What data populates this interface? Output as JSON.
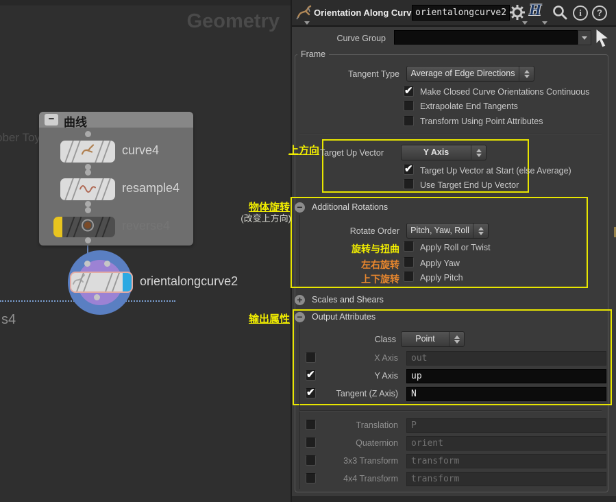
{
  "network": {
    "context_watermark": "Geometry",
    "clipped_box_label": "ober Toy",
    "clipped_node_label": "s4",
    "group_box": {
      "title": "曲线",
      "collapse_glyph": "−"
    },
    "nodes": {
      "curve": {
        "label": "curve4"
      },
      "resample": {
        "label": "resample4"
      },
      "reverse": {
        "label": "reverse4"
      },
      "orient": {
        "label": "orientalongcurve2"
      }
    }
  },
  "params": {
    "header": {
      "title": "Orientation Along Curve",
      "node_name": "orientalongcurve2",
      "info_glyph": "i",
      "help_glyph": "?"
    },
    "curve_group": {
      "label": "Curve Group",
      "value": ""
    },
    "frame": {
      "legend": "Frame",
      "tangent_type": {
        "label": "Tangent Type",
        "value": "Average of Edge Directions"
      },
      "cb1": {
        "label": "Make Closed Curve Orientations Continuous",
        "mark": "✔"
      },
      "cb2": {
        "label": "Extrapolate End Tangents",
        "mark": ""
      },
      "cb3": {
        "label": "Transform Using Point Attributes",
        "mark": ""
      }
    },
    "target_up": {
      "annotation": "上方向",
      "label": "Target Up Vector",
      "value": "Y Axis",
      "cb1": {
        "label": "Target Up Vector at Start (else Average)",
        "mark": "✔"
      },
      "cb2": {
        "label": "Use Target End Up Vector",
        "mark": ""
      }
    },
    "additional_rotations": {
      "annotation": "物体旋转",
      "annotation2": "(改变上方向)",
      "collapse_glyph": "−",
      "title": "Additional Rotations",
      "rotate_order": {
        "label": "Rotate Order",
        "value": "Pitch, Yaw, Roll"
      },
      "row1": {
        "annotation": "旋转与扭曲",
        "label": "Apply Roll or Twist",
        "mark": ""
      },
      "row2": {
        "annotation": "左右旋转",
        "label": "Apply Yaw",
        "mark": ""
      },
      "row3": {
        "annotation": "上下旋转",
        "label": "Apply Pitch",
        "mark": ""
      }
    },
    "scales_shears": {
      "expand_glyph": "+",
      "title": "Scales and Shears"
    },
    "output_attributes": {
      "annotation": "输出属性",
      "collapse_glyph": "−",
      "title": "Output Attributes",
      "class_row": {
        "label": "Class",
        "value": "Point"
      },
      "x_axis": {
        "label": "X Axis",
        "value": "out",
        "mark": ""
      },
      "y_axis": {
        "label": "Y Axis",
        "value": "up",
        "mark": "✔"
      },
      "tangent": {
        "label": "Tangent (Z Axis)",
        "value": "N",
        "mark": "✔"
      },
      "translation": {
        "label": "Translation",
        "value": "P",
        "mark": ""
      },
      "quaternion": {
        "label": "Quaternion",
        "value": "orient",
        "mark": ""
      },
      "xform33": {
        "label": "3x3 Transform",
        "value": "transform",
        "mark": ""
      },
      "xform44": {
        "label": "4x4 Transform",
        "value": "transform",
        "mark": ""
      }
    },
    "colors": {
      "annotation_yellow": "#f2ee00",
      "annotation_orange": "#e6862e",
      "highlight_box": "#e8e600",
      "display_flag_blue": "#2ba9e2",
      "template_flag_yellow": "#e8c41f",
      "selection_halo_outer": "#5a7fc2",
      "selection_halo_inner": "#9c82d4"
    }
  }
}
